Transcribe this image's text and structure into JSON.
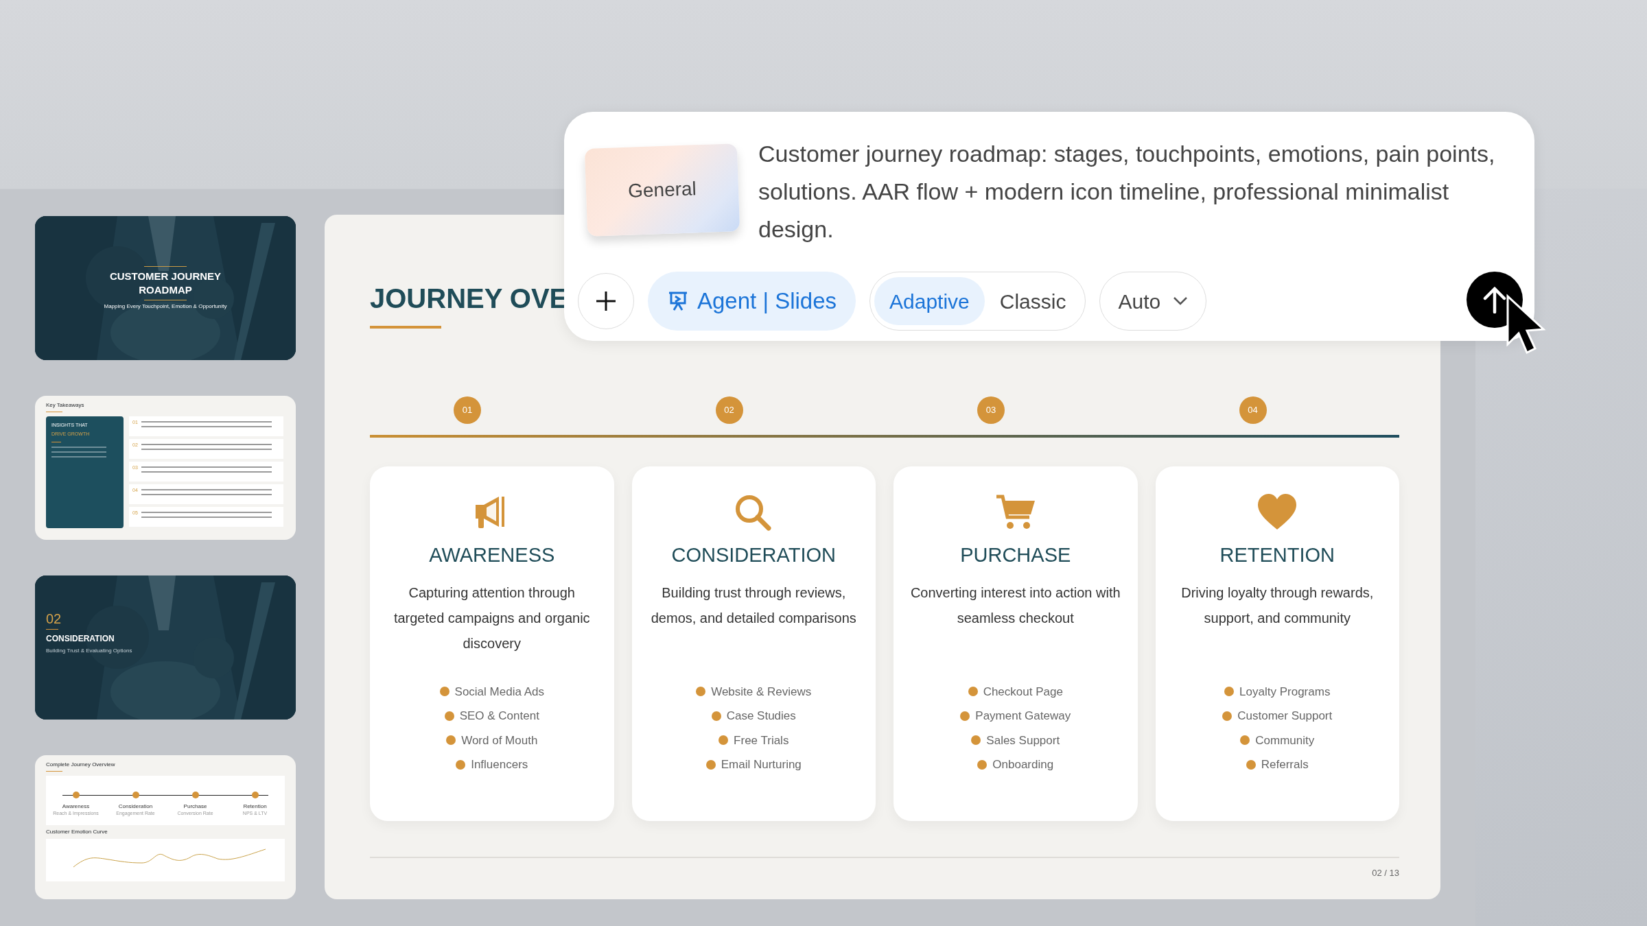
{
  "slides": [
    {
      "kind": "title",
      "title_lines": [
        "CUSTOMER JOURNEY",
        "ROADMAP"
      ],
      "subtitle": "Mapping Every Touchpoint, Emotion & Opportunity"
    },
    {
      "kind": "takeaways",
      "title": "Key Takeaways",
      "panel_lines": [
        "INSIGHTS THAT",
        "DRIVE GROWTH"
      ],
      "items": [
        {
          "number": "01"
        },
        {
          "number": "02"
        },
        {
          "number": "03"
        },
        {
          "number": "04"
        },
        {
          "number": "05"
        }
      ]
    },
    {
      "kind": "section",
      "number": "02",
      "title": "CONSIDERATION",
      "subtitle": "Building Trust & Evaluating Options"
    },
    {
      "kind": "overview",
      "title": "Complete Journey Overview",
      "stages": [
        {
          "label": "Awareness",
          "sub": "Reach & Impressions"
        },
        {
          "label": "Consideration",
          "sub": "Engagement Rate"
        },
        {
          "label": "Purchase",
          "sub": "Conversion Rate"
        },
        {
          "label": "Retention",
          "sub": "NPS & LTV"
        }
      ],
      "curve_title": "Customer Emotion Curve"
    }
  ],
  "slide": {
    "title": "JOURNEY OVE",
    "stages": [
      {
        "number": "01",
        "title": "AWARENESS",
        "description": "Capturing attention through targeted campaigns and organic discovery",
        "touchpoints": [
          "Social Media Ads",
          "SEO & Content",
          "Word of Mouth",
          "Influencers"
        ]
      },
      {
        "number": "02",
        "title": "CONSIDERATION",
        "description": "Building trust through reviews, demos, and detailed comparisons",
        "touchpoints": [
          "Website & Reviews",
          "Case Studies",
          "Free Trials",
          "Email Nurturing"
        ]
      },
      {
        "number": "03",
        "title": "PURCHASE",
        "description": "Converting interest into action with seamless checkout",
        "touchpoints": [
          "Checkout Page",
          "Payment Gateway",
          "Sales Support",
          "Onboarding"
        ]
      },
      {
        "number": "04",
        "title": "RETENTION",
        "description": "Driving loyalty through rewards, support, and community",
        "touchpoints": [
          "Loyalty Programs",
          "Customer Support",
          "Community",
          "Referrals"
        ]
      }
    ],
    "page": "02 / 13"
  },
  "prompt": {
    "tag": "General",
    "text": "Customer journey roadmap: stages, touchpoints, emotions, pain points, solutions. AAR flow + modern icon timeline, professional minimalist design.",
    "agent": "Agent | Slides",
    "modes": [
      {
        "label": "Adaptive",
        "selected": true
      },
      {
        "label": "Classic",
        "selected": false
      }
    ],
    "model": "Auto"
  }
}
